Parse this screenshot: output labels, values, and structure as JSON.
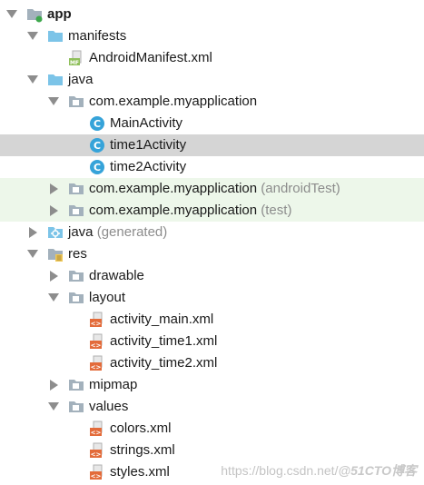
{
  "colors": {
    "folder_blue": "#7cc4e8",
    "folder_gray": "#a3b1bc",
    "class_circle": "#36a3d9",
    "xml_orange": "#e36b3a",
    "android_green": "#3ea84d",
    "selected_row": "#d5d5d5",
    "test_row_tint": "#edf7ea"
  },
  "tree": {
    "nodes": [
      {
        "label": "app",
        "suffix": "",
        "state": "expanded",
        "icon": "module-folder-icon",
        "bold": true
      },
      {
        "label": "manifests",
        "suffix": "",
        "state": "expanded",
        "icon": "folder-icon"
      },
      {
        "label": "AndroidManifest.xml",
        "suffix": "",
        "state": "leaf",
        "icon": "manifest-file-icon",
        "icon_text": "MF"
      },
      {
        "label": "java",
        "suffix": "",
        "state": "expanded",
        "icon": "folder-icon"
      },
      {
        "label": "com.example.myapplication",
        "suffix": "",
        "state": "expanded",
        "icon": "package-icon"
      },
      {
        "label": "MainActivity",
        "suffix": "",
        "state": "leaf",
        "icon": "class-icon",
        "icon_text": "C"
      },
      {
        "label": "time1Activity",
        "suffix": "",
        "state": "leaf",
        "icon": "class-icon",
        "icon_text": "C",
        "selected": true
      },
      {
        "label": "time2Activity",
        "suffix": "",
        "state": "leaf",
        "icon": "class-icon",
        "icon_text": "C"
      },
      {
        "label": "com.example.myapplication",
        "suffix": "(androidTest)",
        "state": "collapsed",
        "icon": "package-icon"
      },
      {
        "label": "com.example.myapplication",
        "suffix": "(test)",
        "state": "collapsed",
        "icon": "package-icon"
      },
      {
        "label": "java",
        "suffix": "(generated)",
        "state": "collapsed",
        "icon": "generated-folder-icon"
      },
      {
        "label": "res",
        "suffix": "",
        "state": "expanded",
        "icon": "resource-folder-icon"
      },
      {
        "label": "drawable",
        "suffix": "",
        "state": "collapsed",
        "icon": "package-icon"
      },
      {
        "label": "layout",
        "suffix": "",
        "state": "expanded",
        "icon": "package-icon"
      },
      {
        "label": "activity_main.xml",
        "suffix": "",
        "state": "leaf",
        "icon": "xml-file-icon",
        "icon_text": "<>"
      },
      {
        "label": "activity_time1.xml",
        "suffix": "",
        "state": "leaf",
        "icon": "xml-file-icon",
        "icon_text": "<>"
      },
      {
        "label": "activity_time2.xml",
        "suffix": "",
        "state": "leaf",
        "icon": "xml-file-icon",
        "icon_text": "<>"
      },
      {
        "label": "mipmap",
        "suffix": "",
        "state": "collapsed",
        "icon": "package-icon"
      },
      {
        "label": "values",
        "suffix": "",
        "state": "expanded",
        "icon": "package-icon"
      },
      {
        "label": "colors.xml",
        "suffix": "",
        "state": "leaf",
        "icon": "xml-file-icon",
        "icon_text": "<>"
      },
      {
        "label": "strings.xml",
        "suffix": "",
        "state": "leaf",
        "icon": "xml-file-icon",
        "icon_text": "<>"
      },
      {
        "label": "styles.xml",
        "suffix": "",
        "state": "leaf",
        "icon": "xml-file-icon",
        "icon_text": "<>"
      }
    ]
  },
  "watermark": {
    "url": "https://blog.csdn.net/",
    "brand": "@51CTO博客"
  }
}
